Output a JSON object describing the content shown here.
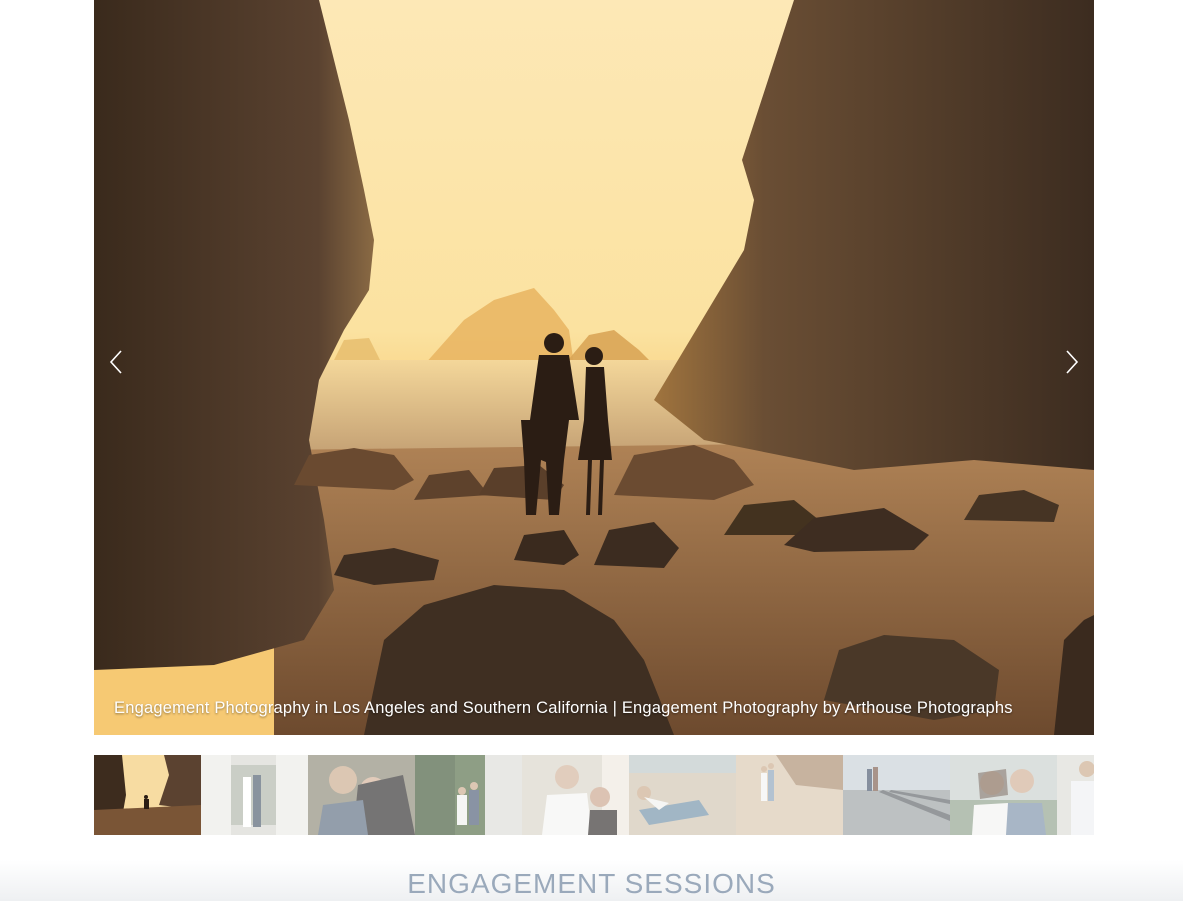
{
  "slideshow": {
    "caption": "Engagement Photography in Los Angeles and Southern California | Engagement Photography by Arthouse Photographs",
    "prev_icon": "chevron-left-icon",
    "next_icon": "chevron-right-icon"
  },
  "thumbnails": [
    {
      "scene": "sunset-beach-cliffs",
      "active": true
    },
    {
      "scene": "couple-in-white-archway",
      "active": false
    },
    {
      "scene": "couple-embrace-closeup",
      "active": false
    },
    {
      "scene": "couple-by-hedge-wall",
      "active": false
    },
    {
      "scene": "couple-smiling-closeup",
      "active": false
    },
    {
      "scene": "couple-lying-on-sand",
      "active": false
    },
    {
      "scene": "couple-on-beach",
      "active": false
    },
    {
      "scene": "couple-on-railroad-tracks",
      "active": false
    },
    {
      "scene": "couple-portrait-outdoors",
      "active": false
    },
    {
      "scene": "man-partial-crop",
      "active": false
    }
  ],
  "section": {
    "title": "ENGAGEMENT SESSIONS"
  },
  "colors": {
    "sky": "#fbe9b8",
    "rock": "#4a3828",
    "title": "#9aa9bb"
  }
}
